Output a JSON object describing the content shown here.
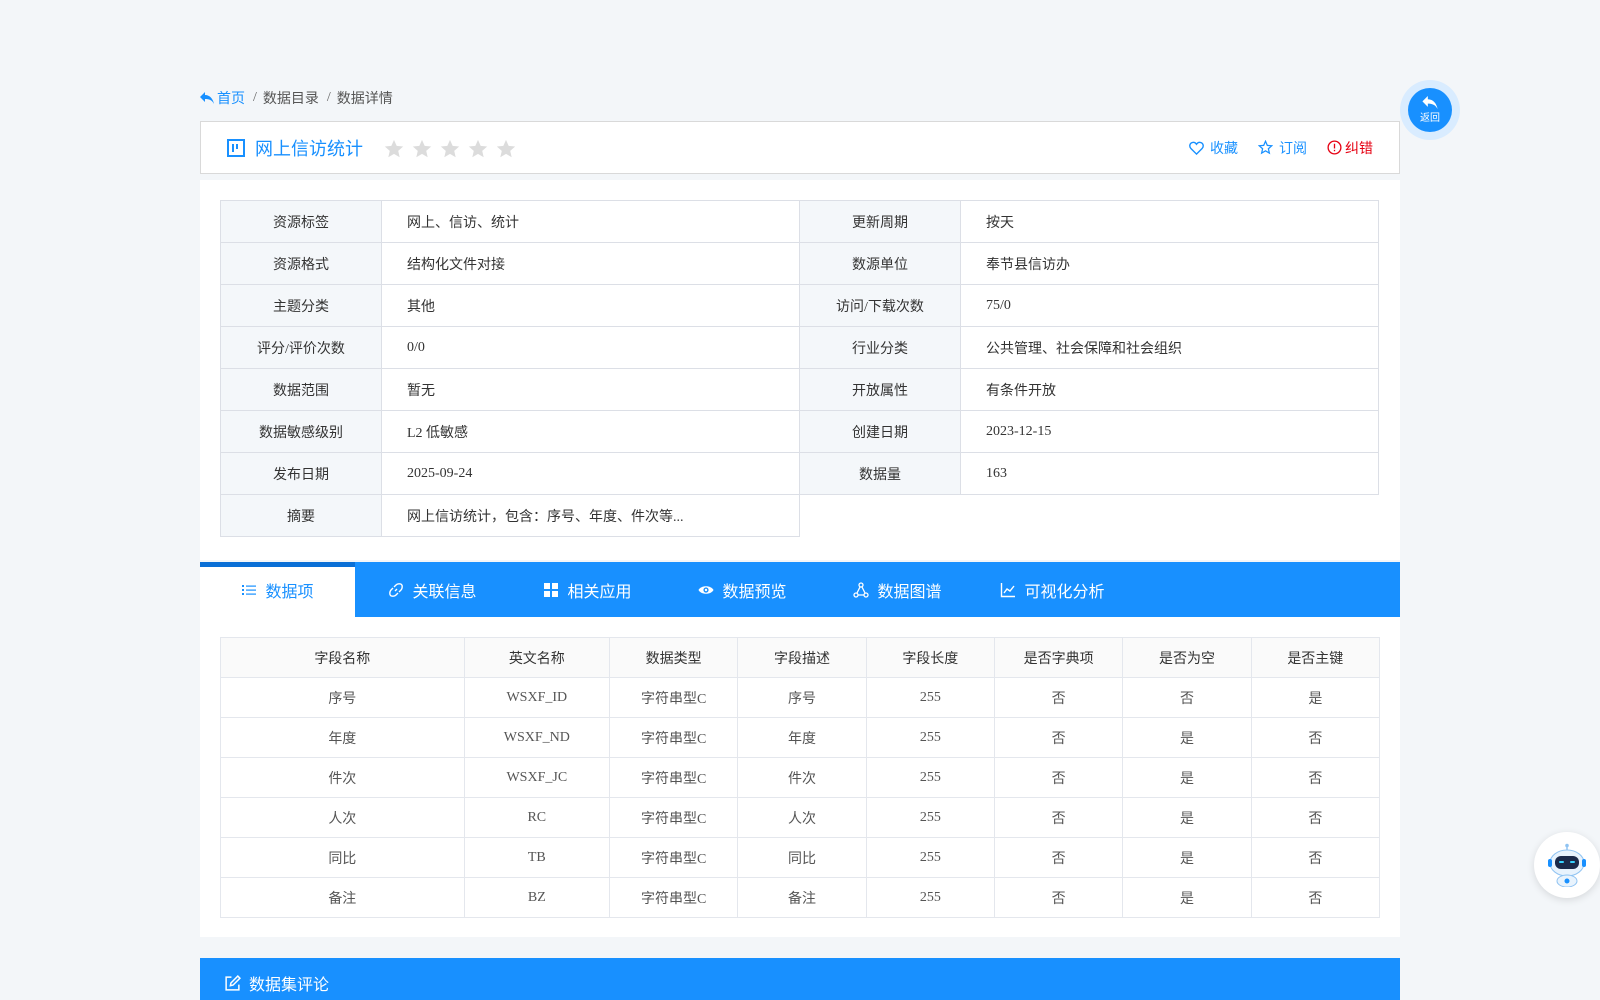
{
  "breadcrumb": {
    "home": "首页",
    "catalog": "数据目录",
    "detail": "数据详情"
  },
  "title": "网上信访统计",
  "rating": {
    "max": 5,
    "filled": 0
  },
  "actions": {
    "favorite": "收藏",
    "subscribe": "订阅",
    "report": "纠错"
  },
  "colors": {
    "primary": "#1890ff",
    "danger": "#e60012",
    "star_empty": "#dcdcdc"
  },
  "info": {
    "r1": {
      "k1": "资源标签",
      "v1": "网上、信访、统计",
      "k2": "更新周期",
      "v2": "按天"
    },
    "r2": {
      "k1": "资源格式",
      "v1": "结构化文件对接",
      "k2": "数源单位",
      "v2": "奉节县信访办"
    },
    "r3": {
      "k1": "主题分类",
      "v1": "其他",
      "k2": "访问/下载次数",
      "v2": "75/0"
    },
    "r4": {
      "k1": "评分/评价次数",
      "v1": "0/0",
      "k2": "行业分类",
      "v2": "公共管理、社会保障和社会组织"
    },
    "r5": {
      "k1": "数据范围",
      "v1": "暂无",
      "k2": "开放属性",
      "v2": "有条件开放"
    },
    "r6": {
      "k1": "数据敏感级别",
      "v1": "L2 低敏感",
      "k2": "创建日期",
      "v2": "2023-12-15"
    },
    "r7": {
      "k1": "发布日期",
      "v1": "2025-09-24",
      "k2": "数据量",
      "v2": "163"
    },
    "r8": {
      "k1": "摘要",
      "v1": "网上信访统计，包含：序号、年度、件次等..."
    }
  },
  "tabs": {
    "t0": "数据项",
    "t1": "关联信息",
    "t2": "相关应用",
    "t3": "数据预览",
    "t4": "数据图谱",
    "t5": "可视化分析",
    "active": "数据项"
  },
  "fields": {
    "headers": {
      "h0": "字段名称",
      "h1": "英文名称",
      "h2": "数据类型",
      "h3": "字段描述",
      "h4": "字段长度",
      "h5": "是否字典项",
      "h6": "是否为空",
      "h7": "是否主键"
    },
    "rows": [
      {
        "c0": "序号",
        "c1": "WSXF_ID",
        "c2": "字符串型C",
        "c3": "序号",
        "c4": "255",
        "c5": "否",
        "c6": "否",
        "c7": "是"
      },
      {
        "c0": "年度",
        "c1": "WSXF_ND",
        "c2": "字符串型C",
        "c3": "年度",
        "c4": "255",
        "c5": "否",
        "c6": "是",
        "c7": "否"
      },
      {
        "c0": "件次",
        "c1": "WSXF_JC",
        "c2": "字符串型C",
        "c3": "件次",
        "c4": "255",
        "c5": "否",
        "c6": "是",
        "c7": "否"
      },
      {
        "c0": "人次",
        "c1": "RC",
        "c2": "字符串型C",
        "c3": "人次",
        "c4": "255",
        "c5": "否",
        "c6": "是",
        "c7": "否"
      },
      {
        "c0": "同比",
        "c1": "TB",
        "c2": "字符串型C",
        "c3": "同比",
        "c4": "255",
        "c5": "否",
        "c6": "是",
        "c7": "否"
      },
      {
        "c0": "备注",
        "c1": "BZ",
        "c2": "字符串型C",
        "c3": "备注",
        "c4": "255",
        "c5": "否",
        "c6": "是",
        "c7": "否"
      }
    ]
  },
  "comment_title": "数据集评论",
  "back_label": "返回"
}
